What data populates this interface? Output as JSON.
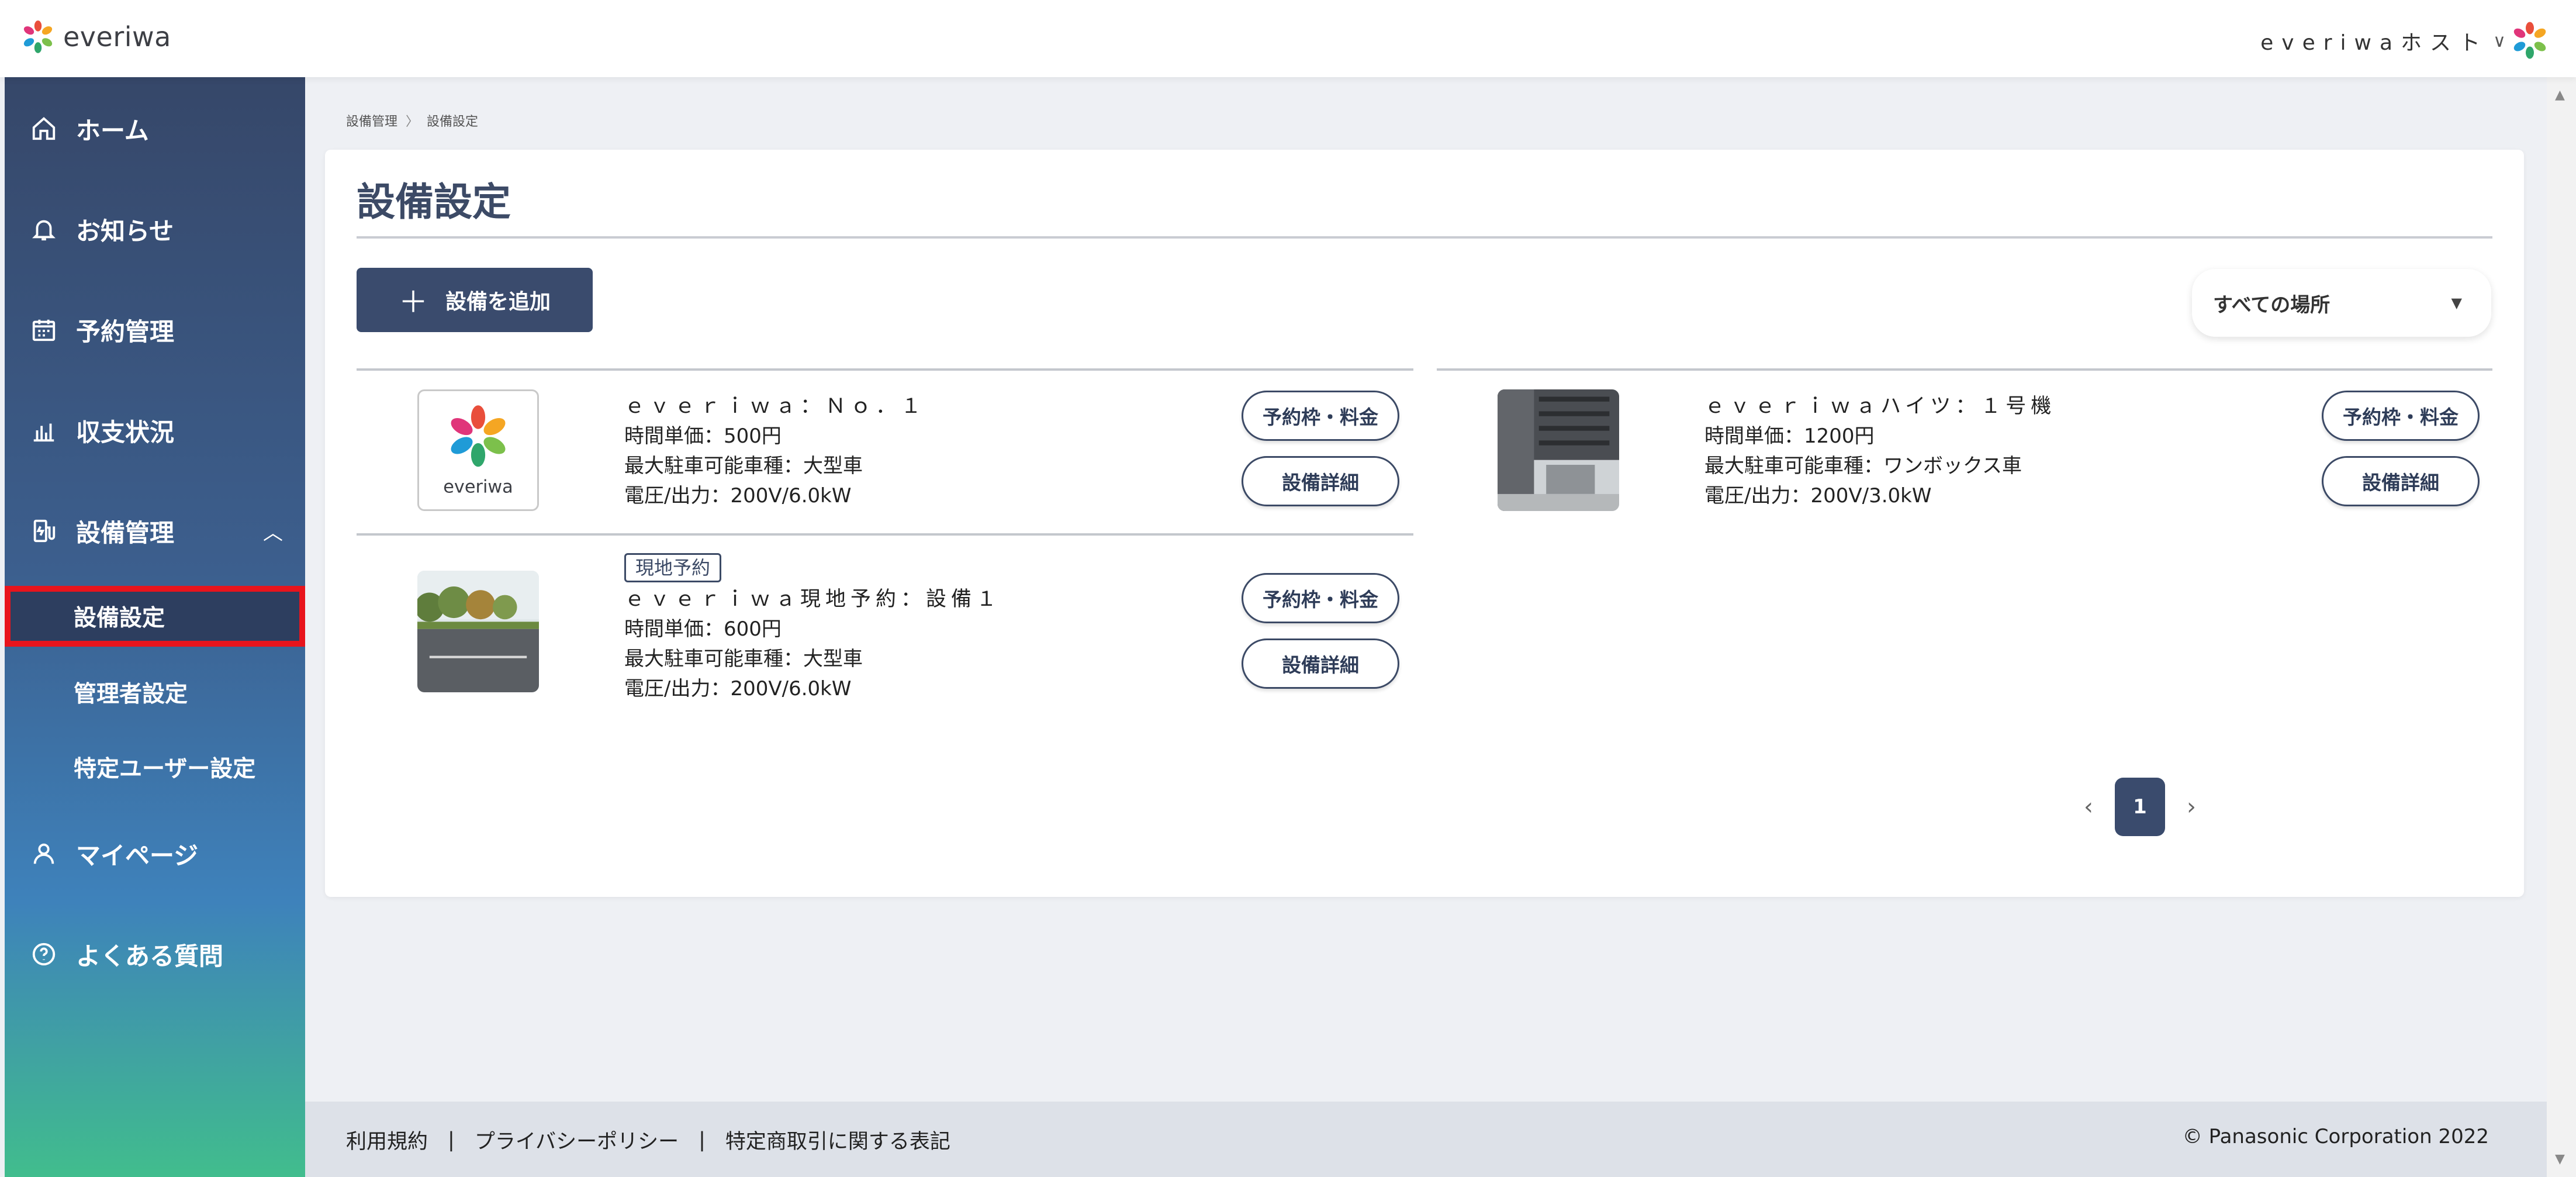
{
  "header": {
    "brand": "everiwa",
    "host_name": "everiwaホスト",
    "host_chevron": "∨"
  },
  "sidebar": {
    "items": [
      {
        "label": "ホーム",
        "icon": "home-icon"
      },
      {
        "label": "お知らせ",
        "icon": "bell-icon"
      },
      {
        "label": "予約管理",
        "icon": "calendar-icon"
      },
      {
        "label": "収支状況",
        "icon": "chart-icon"
      },
      {
        "label": "設備管理",
        "icon": "charger-icon",
        "caret": "︿"
      },
      {
        "label": "マイページ",
        "icon": "user-icon"
      },
      {
        "label": "よくある質問",
        "icon": "question-icon"
      }
    ],
    "sub_items": [
      {
        "label": "設備設定"
      },
      {
        "label": "管理者設定"
      },
      {
        "label": "特定ユーザー設定"
      }
    ]
  },
  "breadcrumb": {
    "parent": "設備管理",
    "sep": "〉",
    "current": "設備設定"
  },
  "page": {
    "title": "設備設定",
    "add_button": "設備を追加",
    "add_plus": "＋",
    "location_select": "すべての場所",
    "location_arrow": "▼"
  },
  "facilities": [
    {
      "name": "ｅｖｅｒｉｗａ：Ｎｏ．１",
      "tag": "",
      "unit_price": "時間単価：500円",
      "max_vehicle": "最大駐車可能車種：大型車",
      "voltage": "電圧/出力：200V/6.0kW",
      "btn_slot": "予約枠・料金",
      "btn_detail": "設備詳細"
    },
    {
      "name": "ｅｖｅｒｉｗａハイツ：１号機",
      "tag": "",
      "unit_price": "時間単価：1200円",
      "max_vehicle": "最大駐車可能車種：ワンボックス車",
      "voltage": "電圧/出力：200V/3.0kW",
      "btn_slot": "予約枠・料金",
      "btn_detail": "設備詳細"
    },
    {
      "name": "ｅｖｅｒｉｗａ現地予約：設備１",
      "tag": "現地予約",
      "unit_price": "時間単価：600円",
      "max_vehicle": "最大駐車可能車種：大型車",
      "voltage": "電圧/出力：200V/6.0kW",
      "btn_slot": "予約枠・料金",
      "btn_detail": "設備詳細"
    }
  ],
  "pagination": {
    "prev": "‹",
    "current": "1",
    "next": "›"
  },
  "footer": {
    "terms": "利用規約",
    "privacy": "プライバシーポリシー",
    "commerce": "特定商取引に関する表記",
    "separator": "|",
    "copyright": "© Panasonic Corporation 2022"
  },
  "colors": {
    "accent": "#3a4b6d",
    "highlight": "#e8141c"
  }
}
